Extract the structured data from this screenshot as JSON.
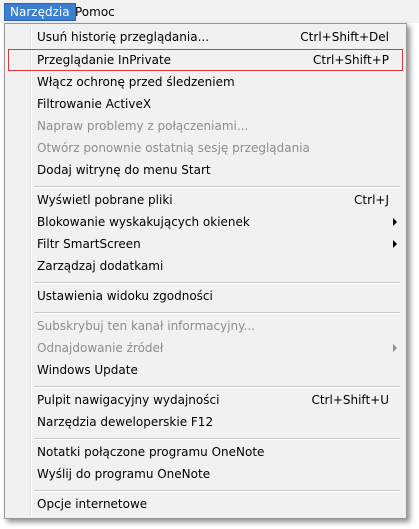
{
  "menubar": {
    "items": [
      "Narzędzia",
      "Pomoc"
    ]
  },
  "menu": {
    "items": [
      {
        "label": "Usuń historię przeglądania...",
        "shortcut": "Ctrl+Shift+Del"
      },
      {
        "label": "Przeglądanie InPrivate",
        "shortcut": "Ctrl+Shift+P"
      },
      {
        "label": "Włącz ochronę przed śledzeniem",
        "shortcut": ""
      },
      {
        "label": "Filtrowanie ActiveX",
        "shortcut": ""
      },
      {
        "label": "Napraw problemy z połączeniami...",
        "shortcut": ""
      },
      {
        "label": "Otwórz ponownie ostatnią sesję przeglądania",
        "shortcut": ""
      },
      {
        "label": "Dodaj witrynę do menu Start",
        "shortcut": ""
      },
      {
        "label": "Wyświetl pobrane pliki",
        "shortcut": "Ctrl+J"
      },
      {
        "label": "Blokowanie wyskakujących okienek",
        "shortcut": ""
      },
      {
        "label": "Filtr SmartScreen",
        "shortcut": ""
      },
      {
        "label": "Zarządzaj dodatkami",
        "shortcut": ""
      },
      {
        "label": "Ustawienia widoku zgodności",
        "shortcut": ""
      },
      {
        "label": "Subskrybuj ten kanał informacyjny...",
        "shortcut": ""
      },
      {
        "label": "Odnajdowanie źródeł",
        "shortcut": ""
      },
      {
        "label": "Windows Update",
        "shortcut": ""
      },
      {
        "label": "Pulpit nawigacyjny wydajności",
        "shortcut": "Ctrl+Shift+U"
      },
      {
        "label": "Narzędzia deweloperskie F12",
        "shortcut": ""
      },
      {
        "label": "Notatki połączone programu OneNote",
        "shortcut": ""
      },
      {
        "label": "Wyślij do programu OneNote",
        "shortcut": ""
      },
      {
        "label": "Opcje internetowe",
        "shortcut": ""
      }
    ]
  }
}
